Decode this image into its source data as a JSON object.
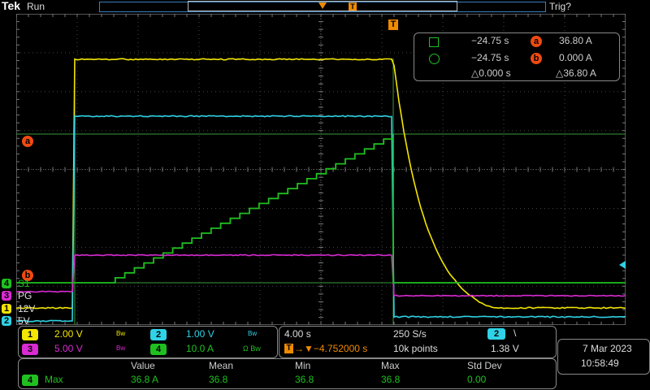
{
  "header": {
    "brand": "Tek",
    "status": "Run",
    "trigger_status": "Trig?"
  },
  "markers": {
    "trigger_marker": "T",
    "cursor_a": "a",
    "cursor_b": "b"
  },
  "channels": [
    {
      "num": "1",
      "label": "12V",
      "color": "#f3e600",
      "scale": "2.00 V",
      "bw": "Bw"
    },
    {
      "num": "2",
      "label": "5V",
      "color": "#2fd2e6",
      "scale": "1.00 V",
      "bw": "Bw"
    },
    {
      "num": "3",
      "label": "PG",
      "color": "#d82bd1",
      "scale": "5.00 V",
      "bw": "Bw"
    },
    {
      "num": "4",
      "label": "S1",
      "color": "#20c020",
      "scale": "10.0 A",
      "bw": "Ω Bw"
    }
  ],
  "cursor_panel": {
    "row1": {
      "time": "−24.75 s",
      "value": "36.80 A"
    },
    "row2": {
      "time": "−24.75 s",
      "value": "0.000 A"
    },
    "delta": {
      "time": "△0.000 s",
      "value": "△36.80 A"
    }
  },
  "horizontal": {
    "scale": "4.00 s",
    "sample_rate": "250 S/s",
    "delay": "→▼−4.752000 s",
    "record": "10k points",
    "trig_source": "2",
    "trig_slope": "\\",
    "trig_level": "1.38 V"
  },
  "datetime": {
    "date": "7 Mar  2023",
    "time": "10:58:49"
  },
  "measurements": {
    "headers": [
      "Value",
      "Mean",
      "Min",
      "Max",
      "Std Dev"
    ],
    "rows": [
      {
        "source": "4",
        "name": "Max",
        "values": [
          "36.8 A",
          "36.8",
          "36.8",
          "36.8",
          "0.00"
        ]
      }
    ]
  }
}
